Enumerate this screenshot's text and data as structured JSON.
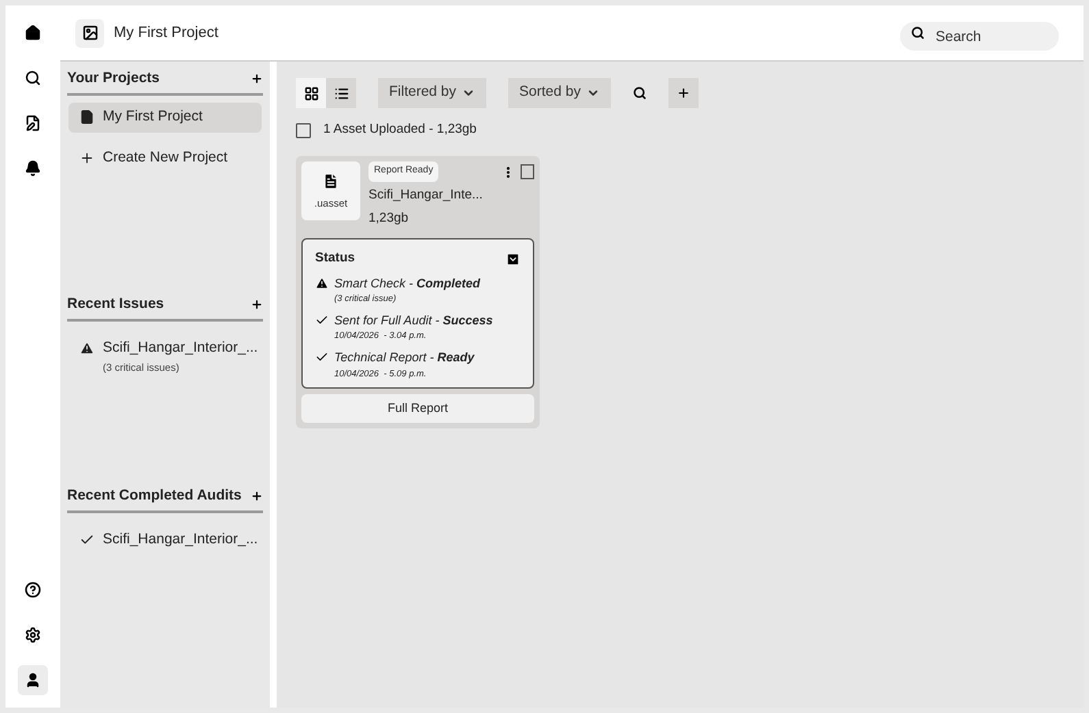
{
  "topbar": {
    "title": "My First Project",
    "search": {
      "placeholder": "Search"
    }
  },
  "rail": {
    "top": [
      {
        "kind": "home",
        "selected": false
      },
      {
        "kind": "search",
        "selected": false
      },
      {
        "kind": "edit",
        "selected": false
      },
      {
        "kind": "bell",
        "selected": false
      }
    ],
    "bottom": [
      {
        "kind": "help",
        "selected": false
      },
      {
        "kind": "settings",
        "selected": false
      },
      {
        "kind": "user",
        "selected": true
      }
    ]
  },
  "sidebar": {
    "sections": [
      {
        "title": "Your Projects",
        "items": [
          {
            "kind": "project",
            "label": "My First Project",
            "selected": true
          },
          {
            "kind": "create",
            "label": "Create New Project",
            "selected": false
          }
        ]
      },
      {
        "title": "Recent Issues",
        "items": [
          {
            "kind": "issue",
            "label": "Scifi_Hangar_Interior_...",
            "sub": "(3 critical issues)",
            "selected": false
          }
        ]
      },
      {
        "title": "Recent Completed Audits",
        "items": [
          {
            "kind": "done",
            "label": "Scifi_Hangar_Interior_...",
            "selected": false
          }
        ]
      }
    ]
  },
  "toolbar": {
    "views": [
      {
        "kind": "grid",
        "selected": true
      },
      {
        "kind": "list",
        "selected": false
      }
    ],
    "filter": "Filtered by",
    "sort": "Sorted by"
  },
  "summary": {
    "checked": false,
    "text": "1 Asset Uploaded - 1,23gb"
  },
  "assets": [
    {
      "ext": ".uasset",
      "badge": "Report Ready",
      "name": "Scifi_Hangar_Inte...",
      "size": "1,23gb",
      "checked": false,
      "status": {
        "title": "Status",
        "expanded": true,
        "items": [
          {
            "kind": "warning",
            "text": "Smart Check - **Completed**",
            "sub": "(3 critical issue)"
          },
          {
            "kind": "check",
            "text": "Sent for Full Audit - **Success**",
            "sub": "10/04/2026  - 3.04 p.m."
          },
          {
            "kind": "check",
            "text": "Technical Report - **Ready**",
            "sub": "10/04/2026  - 5.09 p.m."
          }
        ]
      },
      "action": "Full Report"
    }
  ]
}
